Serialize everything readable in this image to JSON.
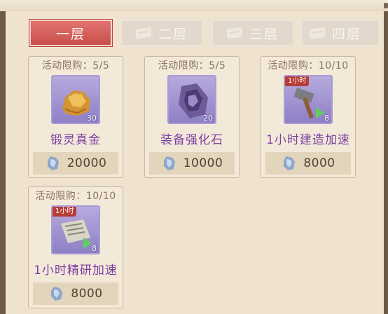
{
  "tabs": [
    {
      "label": "一层",
      "active": true
    },
    {
      "label": "二层",
      "active": false
    },
    {
      "label": "三层",
      "active": false
    },
    {
      "label": "四层",
      "active": false
    }
  ],
  "items": [
    {
      "limit": "活动限购：5/5",
      "name": "锻灵真金",
      "count": "30",
      "price": "20000",
      "icon": "gold-ore-icon"
    },
    {
      "limit": "活动限购：5/5",
      "name": "装备强化石",
      "count": "20",
      "price": "10000",
      "icon": "enhancement-stone-icon"
    },
    {
      "limit": "活动限购：10/10",
      "name": "1小时建造加速",
      "count": "8",
      "price": "8000",
      "tag": "1小时",
      "icon": "hammer-speedup-icon"
    },
    {
      "limit": "活动限购：10/10",
      "name": "1小时精研加速",
      "count": "8",
      "price": "8000",
      "tag": "1小时",
      "icon": "scroll-speedup-icon"
    }
  ],
  "colors": {
    "accent": "#c94e4b",
    "item_name": "#7b3fa3",
    "item_bg": "#9d90cf"
  }
}
